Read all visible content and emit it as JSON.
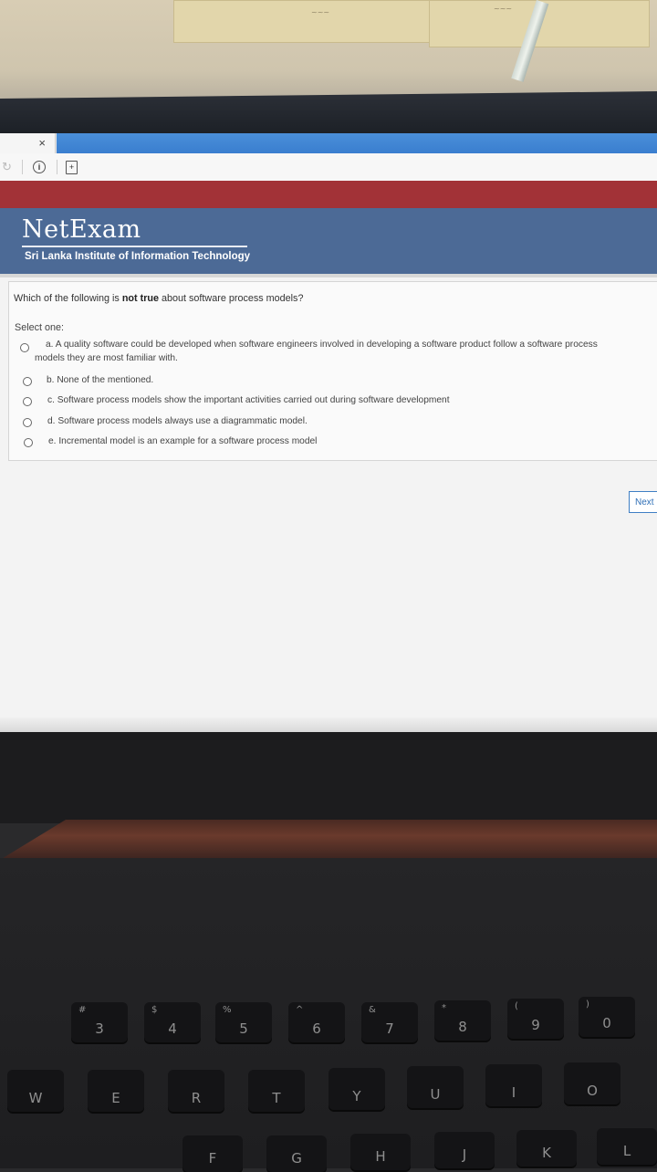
{
  "browser": {
    "tab_close": "×",
    "info_icon": "info-circle-icon",
    "page_icon": "page-plus-icon"
  },
  "header": {
    "logo": "NetExam",
    "subtitle": "Sri Lanka Institute of Information Technology"
  },
  "question": {
    "prefix": "Which of the following is ",
    "emphasis": "not true",
    "suffix": " about software process models?",
    "select_label": "Select one:",
    "options": [
      {
        "line1": "a. A quality software could be developed when software engineers involved in developing a software product follow a software process",
        "line2": "models  they are most familiar with."
      },
      {
        "line1": "b. None of the mentioned."
      },
      {
        "line1": "c. Software process models show the important activities carried out during software development"
      },
      {
        "line1": "d. Software process models always use a diagrammatic model."
      },
      {
        "line1": "e. Incremental model is an example for a software process model"
      }
    ]
  },
  "next_button": "Next",
  "colors": {
    "header_bg": "#4c6a96",
    "red_bar": "#a23237",
    "tab_blue": "#3a7ecf"
  },
  "keyboard": {
    "number_row": [
      {
        "top": "#",
        "main": "3"
      },
      {
        "top": "$",
        "main": "4"
      },
      {
        "top": "%",
        "main": "5"
      },
      {
        "top": "^",
        "main": "6"
      },
      {
        "top": "&",
        "main": "7"
      },
      {
        "top": "*",
        "main": "8"
      },
      {
        "top": "(",
        "main": "9"
      },
      {
        "top": ")",
        "main": "0"
      }
    ],
    "letter_row": [
      "W",
      "E",
      "R",
      "T",
      "Y",
      "U",
      "I",
      "O"
    ],
    "home_row": [
      "F",
      "G",
      "H",
      "J",
      "K",
      "L"
    ]
  }
}
